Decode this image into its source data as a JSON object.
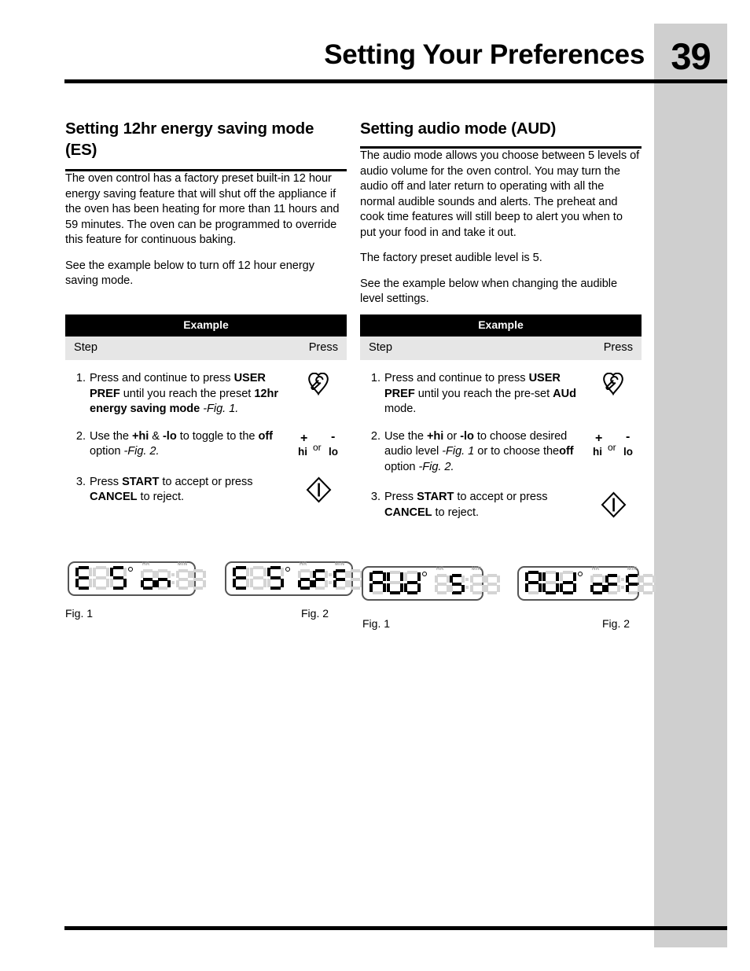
{
  "header": {
    "title": "Setting Your Preferences",
    "page_number": "39"
  },
  "left_column": {
    "heading": "Setting 12hr energy saving mode (ES)",
    "paragraphs": [
      "The oven control has a factory preset built-in 12 hour energy saving feature that will shut off the appliance if the oven has been heating  for more than 11 hours and 59 minutes. The oven can be programmed to override this feature for continuous baking.",
      "See the example below to turn off 12 hour energy saving mode."
    ],
    "table": {
      "caption": "Example",
      "col_step": "Step",
      "col_press": "Press",
      "steps": [
        {
          "number": "1.",
          "icon": "user-pref-wrench-icon"
        },
        {
          "number": "2.",
          "icon": "hi-lo-icon"
        },
        {
          "number": "3.",
          "icon": "start-diamond-icon"
        }
      ]
    },
    "figures": [
      {
        "label": "Fig. 1",
        "display_left": "ES",
        "display_right": "on"
      },
      {
        "label": "Fig. 2",
        "display_left": "ES",
        "display_right": "oFF"
      }
    ]
  },
  "right_column": {
    "heading": "Setting audio mode (AUD)",
    "paragraphs": [
      "The audio mode allows you choose between 5 levels of audio volume for the oven control. You may turn the audio off and later return to operating with all the normal audible sounds and alerts. The preheat and cook time features will still beep to alert you when to put your food in and take it out.",
      "The factory preset audible level is 5.",
      "See the example below when changing the audible level settings."
    ],
    "table": {
      "caption": "Example",
      "col_step": "Step",
      "col_press": "Press",
      "steps": [
        {
          "number": "1.",
          "icon": "user-pref-wrench-icon"
        },
        {
          "number": "2.",
          "icon": "hi-lo-icon"
        },
        {
          "number": "3.",
          "icon": "start-diamond-icon"
        }
      ]
    },
    "figures": [
      {
        "label": "Fig. 1",
        "display_left": "AUd",
        "display_right": "5"
      },
      {
        "label": "Fig. 2",
        "display_left": "AUd",
        "display_right": "oFF"
      }
    ]
  },
  "lcd_labels": {
    "degree": "°",
    "hr": "HR",
    "min": "MIN"
  },
  "hilo_icon": {
    "plus": "+",
    "minus": "-",
    "hi": "hi",
    "or": "or",
    "lo": "lo"
  },
  "colors": {
    "sidebar_gray": "#cfcfcf",
    "table_header_black": "#000000",
    "table_subhead_gray": "#e6e6e6",
    "lcd_off_segment": "#d4d4d4"
  }
}
